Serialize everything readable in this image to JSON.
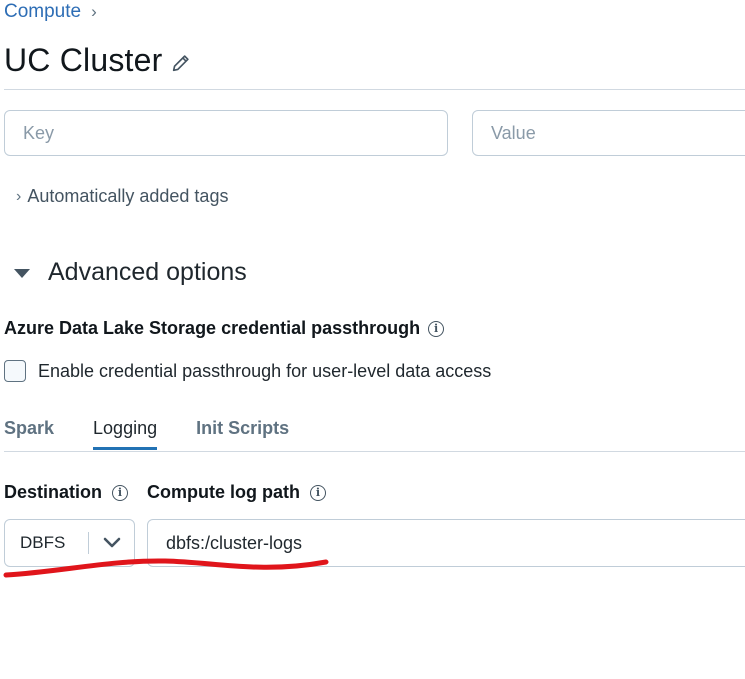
{
  "breadcrumb": {
    "parent": "Compute"
  },
  "page": {
    "title": "UC Cluster"
  },
  "tags": {
    "key_placeholder": "Key",
    "value_placeholder": "Value",
    "auto_tags_label": "Automatically added tags"
  },
  "advanced": {
    "title": "Advanced options",
    "adls_label": "Azure Data Lake Storage credential passthrough",
    "passthrough_checkbox_label": "Enable credential passthrough for user-level data access",
    "passthrough_checked": false
  },
  "tabs": [
    {
      "label": "Spark",
      "active": false
    },
    {
      "label": "Logging",
      "active": true
    },
    {
      "label": "Init Scripts",
      "active": false
    }
  ],
  "logging": {
    "destination_label": "Destination",
    "destination_value": "DBFS",
    "log_path_label": "Compute log path",
    "log_path_value": "dbfs:/cluster-logs"
  },
  "colors": {
    "link": "#2d6db5",
    "tab_underline": "#2272b4",
    "annotation_stroke": "#e0151b"
  }
}
